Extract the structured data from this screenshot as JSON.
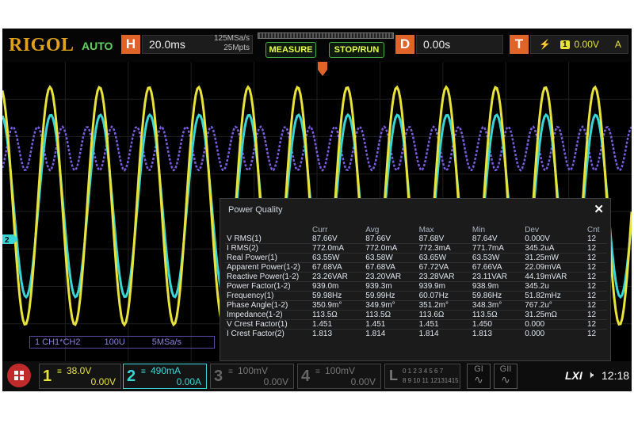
{
  "top": {
    "logo": "RIGOL",
    "mode": "AUTO",
    "h_label": "H",
    "timebase": "20.0ms",
    "sample_rate": "125MSa/s",
    "memory_depth": "25Mpts",
    "measure_btn": "MEASURE",
    "stoprun_btn": "STOP/RUN",
    "d_label": "D",
    "delay": "0.00s",
    "t_label": "T",
    "trigger_source": "1",
    "trigger_level": "0.00V",
    "trigger_mode": "A"
  },
  "pq": {
    "title": "Power Quality",
    "close": "✕",
    "headers": [
      "",
      "Curr",
      "Avg",
      "Max",
      "Min",
      "Dev",
      "Cnt"
    ],
    "rows": [
      [
        "V RMS(1)",
        "87.66V",
        "87.66V",
        "87.68V",
        "87.64V",
        "0.000V",
        "12"
      ],
      [
        "I RMS(2)",
        "772.0mA",
        "772.0mA",
        "772.3mA",
        "771.7mA",
        "345.2uA",
        "12"
      ],
      [
        "Real Power(1)",
        "63.55W",
        "63.58W",
        "63.65W",
        "63.53W",
        "31.25mW",
        "12"
      ],
      [
        "Apparent Power(1-2)",
        "67.68VA",
        "67.68VA",
        "67.72VA",
        "67.66VA",
        "22.09mVA",
        "12"
      ],
      [
        "Reactive Power(1-2)",
        "23.26VAR",
        "23.20VAR",
        "23.28VAR",
        "23.11VAR",
        "44.19mVAR",
        "12"
      ],
      [
        "Power Factor(1-2)",
        "939.0m",
        "939.3m",
        "939.9m",
        "938.9m",
        "345.2u",
        "12"
      ],
      [
        "Frequency(1)",
        "59.98Hz",
        "59.99Hz",
        "60.07Hz",
        "59.86Hz",
        "51.82mHz",
        "12"
      ],
      [
        "Phase Angle(1-2)",
        "350.9m°",
        "349.9m°",
        "351.2m°",
        "348.3m°",
        "767.2u°",
        "12"
      ],
      [
        "Impedance(1-2)",
        "113.5Ω",
        "113.5Ω",
        "113.6Ω",
        "113.5Ω",
        "31.25mΩ",
        "12"
      ],
      [
        "V Crest Factor(1)",
        "1.451",
        "1.451",
        "1.451",
        "1.450",
        "0.000",
        "12"
      ],
      [
        "I Crest Factor(2)",
        "1.813",
        "1.814",
        "1.814",
        "1.813",
        "0.000",
        "12"
      ]
    ]
  },
  "math": {
    "label": "1 CH1*CH2",
    "scale": "100U",
    "rate": "5MSa/s"
  },
  "channels": [
    {
      "num": "1",
      "scale": "38.0V",
      "offset": "0.00V",
      "color": "#e8e23a"
    },
    {
      "num": "2",
      "scale": "490mA",
      "offset": "0.00A",
      "color": "#38d6d6"
    },
    {
      "num": "3",
      "scale": "100mV",
      "offset": "0.00V",
      "color": "#666666"
    },
    {
      "num": "4",
      "scale": "100mV",
      "offset": "0.00V",
      "color": "#666666"
    }
  ],
  "bottom": {
    "la_label": "L",
    "la_row1": "0 1 2 3  4 5 6 7",
    "la_row2": "8 9 10 11 12131415",
    "g1": "GI",
    "g2": "GII",
    "lxi": "LXI",
    "clock": "12:18"
  },
  "marker_ch2": "2",
  "colors": {
    "ch1": "#e8e23a",
    "ch2": "#38d6d6",
    "math": "#7a5ce0",
    "accent": "#e0642a",
    "logo": "#e0a020"
  }
}
